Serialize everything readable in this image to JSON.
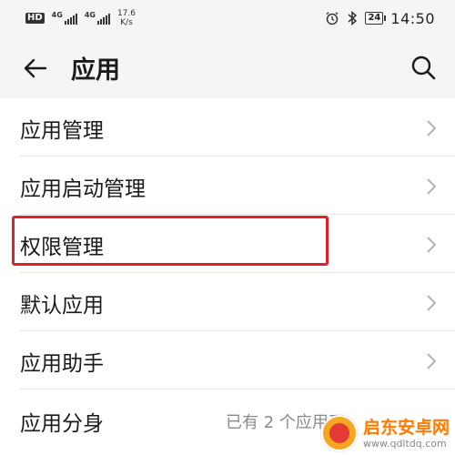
{
  "status_bar": {
    "hd": "HD",
    "signal1_tag": "4G",
    "signal2_tag": "4G",
    "net_speed_value": "17.6",
    "net_speed_unit": "K/s",
    "battery": "24",
    "time": "14:50"
  },
  "header": {
    "title": "应用"
  },
  "list": {
    "items": [
      {
        "label": "应用管理"
      },
      {
        "label": "应用启动管理"
      },
      {
        "label": "权限管理"
      },
      {
        "label": "默认应用"
      },
      {
        "label": "应用助手"
      },
      {
        "label": "应用分身",
        "value": "已有 2 个应用正"
      }
    ]
  },
  "watermark": {
    "name": "启东安卓网",
    "url": "www.qdltdq.com"
  },
  "colors": {
    "highlight": "#e0202e",
    "background": "#f5f5f5",
    "list_background": "#ffffff"
  },
  "icons": {
    "back": "arrow-left-icon",
    "search": "search-icon",
    "chevron": "chevron-right-icon"
  }
}
